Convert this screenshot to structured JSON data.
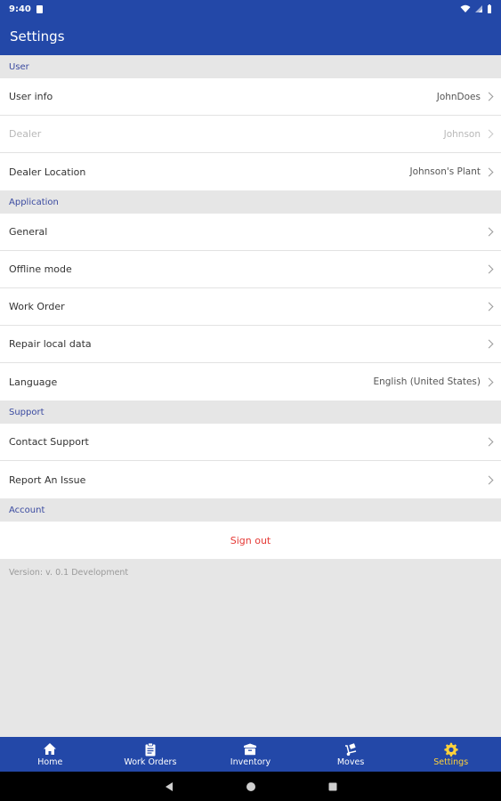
{
  "status_bar": {
    "time": "9:40"
  },
  "app_bar": {
    "title": "Settings"
  },
  "sections": {
    "user": {
      "header": "User",
      "rows": [
        {
          "label": "User info",
          "value": "JohnDoes"
        },
        {
          "label": "Dealer",
          "value": "Johnson"
        },
        {
          "label": "Dealer Location",
          "value": "Johnson's Plant"
        }
      ]
    },
    "application": {
      "header": "Application",
      "rows": [
        {
          "label": "General",
          "value": ""
        },
        {
          "label": "Offline mode",
          "value": ""
        },
        {
          "label": "Work Order",
          "value": ""
        },
        {
          "label": "Repair local data",
          "value": ""
        },
        {
          "label": "Language",
          "value": "English (United States)"
        }
      ]
    },
    "support": {
      "header": "Support",
      "rows": [
        {
          "label": "Contact Support"
        },
        {
          "label": "Report An Issue"
        }
      ]
    },
    "account": {
      "header": "Account",
      "sign_out": "Sign out"
    }
  },
  "version": "Version: v. 0.1 Development",
  "bottom_nav": [
    {
      "label": "Home",
      "icon": "home-icon"
    },
    {
      "label": "Work Orders",
      "icon": "clipboard-icon"
    },
    {
      "label": "Inventory",
      "icon": "box-icon"
    },
    {
      "label": "Moves",
      "icon": "dolly-icon"
    },
    {
      "label": "Settings",
      "icon": "gear-icon",
      "active": true
    }
  ],
  "colors": {
    "primary": "#2348a8",
    "active_nav": "#ffd23a",
    "sign_out": "#e53935"
  }
}
